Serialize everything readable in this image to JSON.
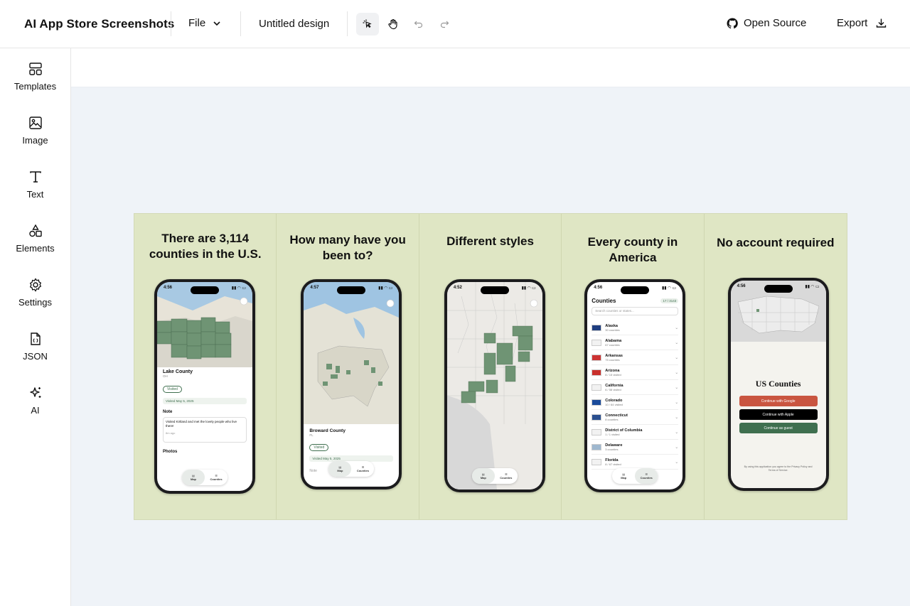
{
  "app": {
    "title": "AI App Store Screenshots",
    "file_menu": "File",
    "doc_name": "Untitled design",
    "open_source": "Open Source",
    "export": "Export"
  },
  "toolbar": {
    "icons": [
      "pointer-icon",
      "hand-icon",
      "undo-icon",
      "redo-icon"
    ]
  },
  "sidebar": {
    "items": [
      {
        "label": "Templates",
        "icon": "templates-icon"
      },
      {
        "label": "Image",
        "icon": "image-icon"
      },
      {
        "label": "Text",
        "icon": "text-icon"
      },
      {
        "label": "Elements",
        "icon": "elements-icon"
      },
      {
        "label": "Settings",
        "icon": "gear-icon"
      },
      {
        "label": "JSON",
        "icon": "json-file-icon"
      },
      {
        "label": "AI",
        "icon": "sparkles-icon"
      }
    ]
  },
  "colors": {
    "board_bg": "#dfe6c4",
    "canvas_bg": "#eff3f8",
    "accent_green": "#3f6f4f",
    "google_red": "#c95540"
  },
  "panels": [
    {
      "title": "There are  3,114 counties in the U.S.",
      "time": "4:56",
      "county": "Lake County",
      "county_sub": "OH",
      "badge": "Visited",
      "date": "Visited May 5, 2025",
      "note_label": "Note",
      "note_text": "Visited Kirtland and met the lovely people who live there!",
      "note_time": "8m ago",
      "photos_label": "Photos",
      "tab_map": "Map",
      "tab_counties": "Counties"
    },
    {
      "title": "How many have you been to?",
      "time": "4:57",
      "county": "Broward County",
      "county_sub": "FL",
      "badge": "Visited",
      "date": "Visited May 5, 2025",
      "note_label": "Note",
      "tab_map": "Map",
      "tab_counties": "Counties"
    },
    {
      "title": "Different styles",
      "time": "4:52",
      "tab_map": "Map",
      "tab_counties": "Counties"
    },
    {
      "title": "Every county in America",
      "time": "4:56",
      "list_title": "Counties",
      "list_count": "17 / 3143",
      "search_placeholder": "Search counties or states...",
      "tab_map": "Map",
      "tab_counties": "Counties",
      "states": [
        {
          "name": "Alaska",
          "sub": "30 counties"
        },
        {
          "name": "Alabama",
          "sub": "67 counties"
        },
        {
          "name": "Arkansas",
          "sub": "75 counties"
        },
        {
          "name": "Arizona",
          "sub": "8 / 15 visited"
        },
        {
          "name": "California",
          "sub": "6 / 58 visited"
        },
        {
          "name": "Colorado",
          "sub": "10 / 64 visited"
        },
        {
          "name": "Connecticut",
          "sub": "8 counties"
        },
        {
          "name": "District of Columbia",
          "sub": "1 / 1 visited"
        },
        {
          "name": "Delaware",
          "sub": "3 counties"
        },
        {
          "name": "Florida",
          "sub": "8 / 67 visited"
        }
      ]
    },
    {
      "title": "No account required",
      "time": "4:56",
      "app_name": "US Counties",
      "btn_google": "Continue with Google",
      "btn_apple": "Continue with Apple",
      "btn_guest": "Continue as guest",
      "legal": "By using this application you agree to the Privacy Policy and Terms of Service."
    }
  ]
}
